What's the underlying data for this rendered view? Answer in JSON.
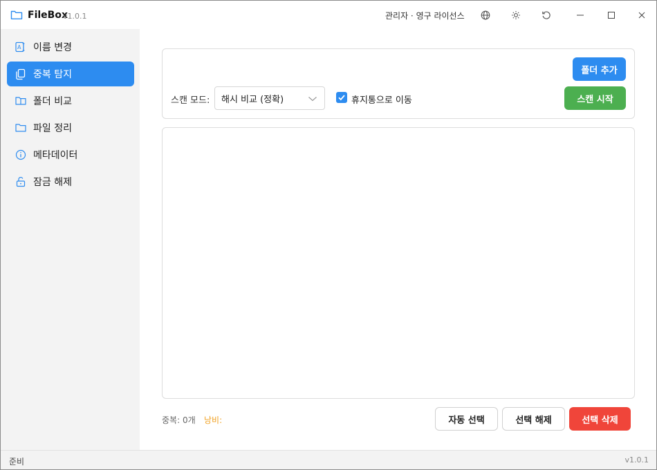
{
  "app": {
    "name": "FileBox",
    "version": "v1.0.1",
    "license": "관리자 · 영구 라이선스"
  },
  "sidebar": {
    "items": [
      {
        "label": "이름 변경",
        "icon": "rename-icon"
      },
      {
        "label": "중복 탐지",
        "icon": "copy-icon"
      },
      {
        "label": "폴더 비교",
        "icon": "folder-compare-icon"
      },
      {
        "label": "파일 정리",
        "icon": "folder-icon"
      },
      {
        "label": "메타데이터",
        "icon": "info-icon"
      },
      {
        "label": "잠금 해제",
        "icon": "unlock-icon"
      }
    ],
    "active_index": 1
  },
  "toolbar": {
    "add_folder_label": "폴더 추가",
    "scan_mode_label": "스캔 모드:",
    "scan_mode_value": "해시 비교 (정확)",
    "trash_label": "휴지통으로 이동",
    "trash_checked": true,
    "start_scan_label": "스캔 시작"
  },
  "footer": {
    "duplicates_label": "중복: 0개",
    "waste_label": "낭비:",
    "auto_select_label": "자동 선택",
    "deselect_label": "선택 해제",
    "delete_selected_label": "선택 삭제"
  },
  "statusbar": {
    "status": "준비",
    "version": "v1.0.1"
  },
  "colors": {
    "accent": "#2d8cf0",
    "success": "#4caf50",
    "danger": "#f0453a",
    "warning": "#f0a020"
  }
}
